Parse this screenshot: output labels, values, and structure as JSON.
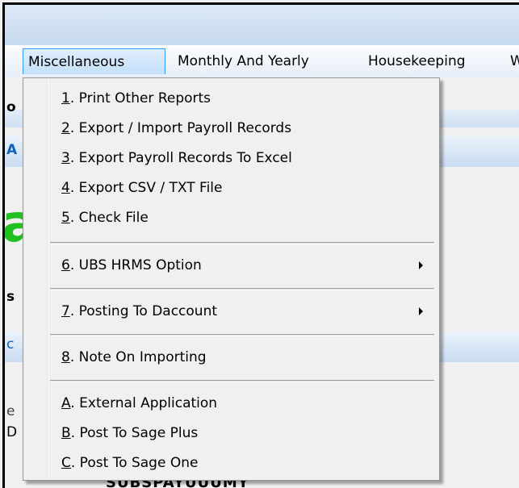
{
  "menubar": {
    "items": [
      {
        "label": "Miscellaneous",
        "active": true
      },
      {
        "label": "Monthly And Yearly"
      },
      {
        "label": "Housekeeping"
      },
      {
        "label": "W"
      }
    ]
  },
  "background": {
    "fragments": [
      "o",
      "A",
      "a",
      "s",
      "c",
      "e",
      "D",
      "SUBSPAYUUUMY"
    ]
  },
  "dropdown": {
    "items": [
      {
        "key": "1",
        "label": ". Print Other Reports"
      },
      {
        "key": "2",
        "label": ". Export / Import Payroll Records"
      },
      {
        "key": "3",
        "label": ". Export Payroll Records To Excel"
      },
      {
        "key": "4",
        "label": ". Export CSV / TXT File"
      },
      {
        "key": "5",
        "label": ". Check File"
      },
      {
        "key": "6",
        "label": ". UBS HRMS Option",
        "submenu": true
      },
      {
        "key": "7",
        "label": ". Posting To Daccount",
        "submenu": true
      },
      {
        "key": "8",
        "label": ". Note On Importing"
      },
      {
        "key": "A",
        "label": ". External Application"
      },
      {
        "key": "B",
        "label": ". Post To Sage Plus"
      },
      {
        "key": "C",
        "label": ". Post To Sage One"
      }
    ]
  },
  "colors": {
    "highlight_border": "#3399ff",
    "menubar": "#e7eef8",
    "background_text_green": "#20c020"
  }
}
